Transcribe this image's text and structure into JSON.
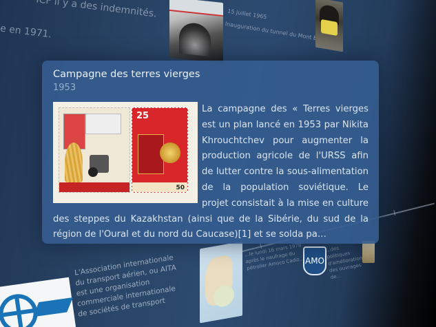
{
  "background": {
    "fragment_line1": "ICF il y a des indemnités.",
    "fragment_line2": "",
    "fragment_line3": "e en 1971.",
    "caption_top": "15 juillet 1965",
    "caption_top2": "Inauguration du tunnel du Mont Blanc",
    "iata_text": "L'Association internationale du transport aérien, ou AITA est une organisation commerciale internationale de sociétés de transport",
    "map_text": "…le lundi 16 mars 1978 après le naufrage du pétrolier Amoco Cadiz…",
    "right_text": "…des politiques d'amélioration des ouvrages de…"
  },
  "popup": {
    "title": "Campagne des terres vierges",
    "year": "1953",
    "body": "La campagne des « Terres vierges est un plan lancé en 1953 par Nikita Khrouchtchev pour augmenter la production agricole de l'URSS afin de lutter contre la sous-alimentation de la population soviétique. Le projet consistait à la mise en culture des steppes du Kazakhstan (ainsi que de la Sibérie, du sud de la région de l'Oural et du nord du Caucase)[1] et se solda pa…",
    "stamp_value": "25",
    "stamp_price": "50"
  },
  "badge": {
    "label": "AMO"
  },
  "colors": {
    "popup_bg": "#345c8e",
    "background_blue": "#2a4668",
    "text_light": "#dbe4ef",
    "year_color": "#98aec8"
  }
}
